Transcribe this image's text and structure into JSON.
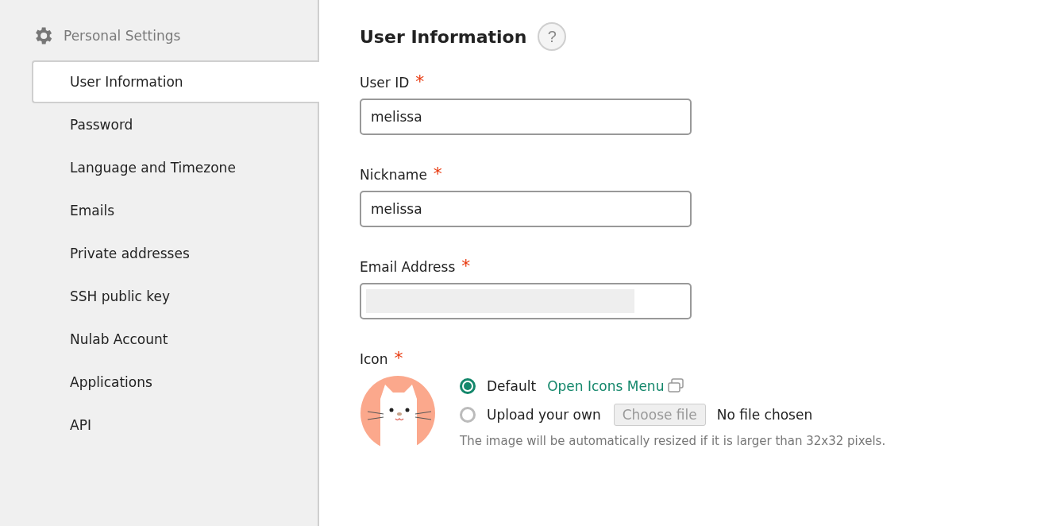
{
  "sidebar": {
    "heading": "Personal Settings",
    "items": [
      {
        "label": "User Information",
        "selected": true
      },
      {
        "label": "Password",
        "selected": false
      },
      {
        "label": "Language and Timezone",
        "selected": false
      },
      {
        "label": "Emails",
        "selected": false
      },
      {
        "label": "Private addresses",
        "selected": false
      },
      {
        "label": "SSH public key",
        "selected": false
      },
      {
        "label": "Nulab Account",
        "selected": false
      },
      {
        "label": "Applications",
        "selected": false
      },
      {
        "label": "API",
        "selected": false
      }
    ]
  },
  "main": {
    "title": "User Information",
    "help": "?",
    "fields": [
      {
        "label": "User ID",
        "required": "*",
        "value": "melissa",
        "redacted": false
      },
      {
        "label": "Nickname",
        "required": "*",
        "value": "melissa",
        "redacted": false
      },
      {
        "label": "Email Address",
        "required": "*",
        "redacted": true
      }
    ],
    "icon": {
      "label": "Icon",
      "required": "*",
      "options": [
        {
          "kind": "link",
          "label": "Default",
          "selected": true,
          "link": "Open Icons Menu"
        },
        {
          "kind": "file",
          "label": "Upload your own",
          "selected": false,
          "button": "Choose file",
          "status": "No file chosen"
        }
      ],
      "note": "The image will be automatically resized if it is larger than 32x32 pixels."
    }
  }
}
